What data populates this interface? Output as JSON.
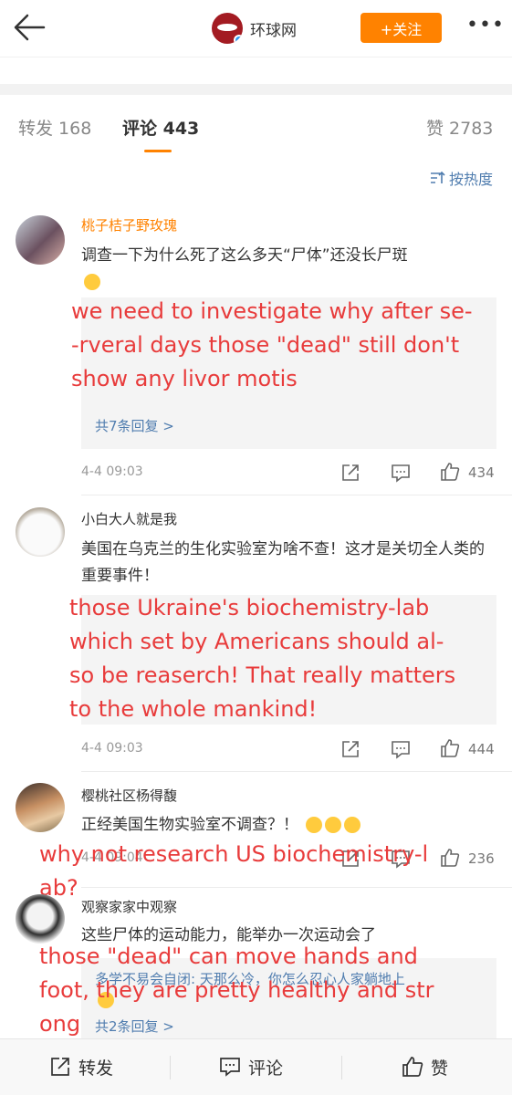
{
  "header": {
    "account_name": "环球网",
    "follow_label": "+关注"
  },
  "tabs": {
    "repost": "转发 168",
    "comments": "评论 443",
    "likes": "赞 2783"
  },
  "sort_label": "按热度",
  "comments": [
    {
      "user": "桃子桔子野玫瑰",
      "text": "调查一下为什么死了这么多天“尸体”还没长尸斑",
      "translation": [
        "we need to investigate why after se-",
        "-rveral days those \"dead\" still don't",
        " show any livor motis"
      ],
      "replies_link": "共7条回复 >",
      "time": "4-4 09:03",
      "likes": "434"
    },
    {
      "user": "小白大人就是我",
      "text": "美国在乌克兰的生化实验室为啥不查！这才是关切全人类的重要事件！",
      "translation": [
        "those Ukraine's biochemistry-lab",
        "which set by Americans should al-",
        "so be reaserch! That really matters",
        "to the whole mankind!"
      ],
      "time": "4-4 09:03",
      "likes": "444"
    },
    {
      "user": "樱桃社区杨得馥",
      "text": "正经美国生物实验室不调查？！",
      "translation": [
        "why not research US biochemistry-l",
        "ab?"
      ],
      "time": "4-4 09:04",
      "likes": "236"
    },
    {
      "user": "观察家家中观察",
      "text": "这些尸体的运动能力，能举办一次运动会了",
      "reply_preview": "多学不易会自闭: 天那么冷，你怎么忍心人家躺地上",
      "translation": [
        "those \"dead\" can move hands and",
        "foot, they are pretty healthy and str",
        "ong"
      ],
      "replies_link": "共2条回复 >"
    }
  ],
  "bottom_bar": {
    "repost": "转发",
    "comment": "评论",
    "like": "赞"
  }
}
